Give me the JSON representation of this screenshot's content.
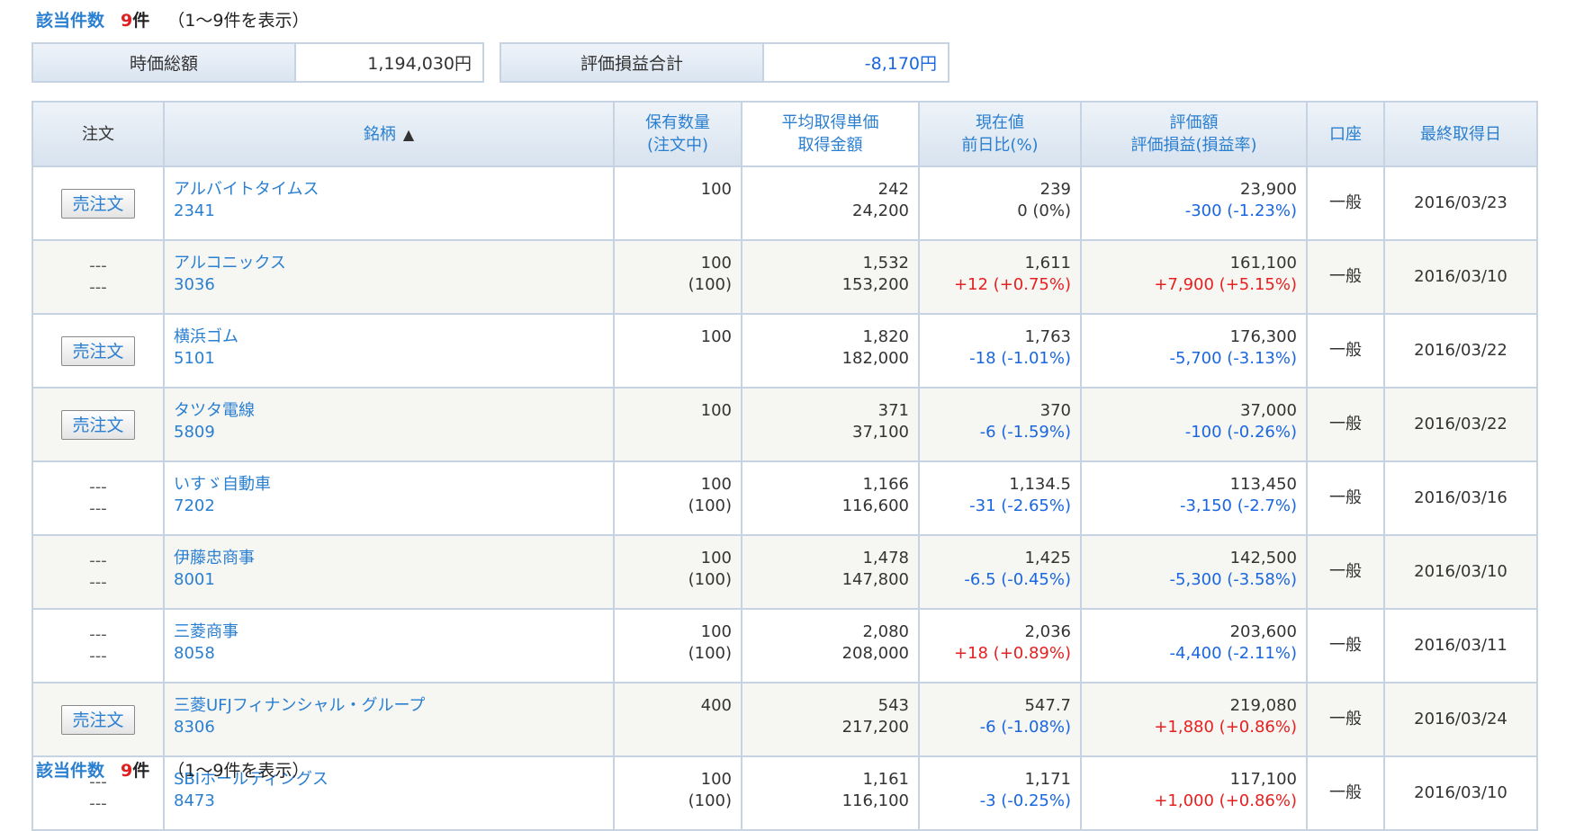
{
  "header_count": {
    "label": "該当件数",
    "count": "9",
    "unit": "件",
    "range": "（1～9件を表示）"
  },
  "summary": {
    "market_value_label": "時価総額",
    "market_value": "1,194,030円",
    "pl_total_label": "評価損益合計",
    "pl_total": "-8,170円"
  },
  "columns": {
    "order": "注文",
    "name": "銘柄",
    "sort_icon": "▲",
    "qty_1": "保有数量",
    "qty_2": "(注文中)",
    "avg_1": "平均取得単価",
    "avg_2": "取得金額",
    "price_1": "現在値",
    "price_2": "前日比(%)",
    "val_1": "評価額",
    "val_2": "評価損益(損益率)",
    "account": "口座",
    "last_date": "最終取得日"
  },
  "colors": {
    "positive": "#e62020",
    "negative": "#1a66e0",
    "link": "#2a7fd0"
  },
  "rows": [
    {
      "order_type": "button",
      "order": "売注文",
      "name": "アルバイトタイムス",
      "code": "2341",
      "qty": "100",
      "qty_pending": "",
      "avg_price": "242",
      "acq_amount": "24,200",
      "price": "239",
      "change": "0 (0%)",
      "change_sign": "zero",
      "valuation": "23,900",
      "pl": "-300 (-1.23%)",
      "pl_sign": "neg",
      "account": "一般",
      "date": "2016/03/23"
    },
    {
      "order_type": "dash",
      "order_1": "---",
      "order_2": "---",
      "name": "アルコニックス",
      "code": "3036",
      "qty": "100",
      "qty_pending": "(100)",
      "avg_price": "1,532",
      "acq_amount": "153,200",
      "price": "1,611",
      "change": "+12 (+0.75%)",
      "change_sign": "pos",
      "valuation": "161,100",
      "pl": "+7,900 (+5.15%)",
      "pl_sign": "pos",
      "account": "一般",
      "date": "2016/03/10"
    },
    {
      "order_type": "button",
      "order": "売注文",
      "name": "横浜ゴム",
      "code": "5101",
      "qty": "100",
      "qty_pending": "",
      "avg_price": "1,820",
      "acq_amount": "182,000",
      "price": "1,763",
      "change": "-18 (-1.01%)",
      "change_sign": "neg",
      "valuation": "176,300",
      "pl": "-5,700 (-3.13%)",
      "pl_sign": "neg",
      "account": "一般",
      "date": "2016/03/22"
    },
    {
      "order_type": "button",
      "order": "売注文",
      "name": "タツタ電線",
      "code": "5809",
      "qty": "100",
      "qty_pending": "",
      "avg_price": "371",
      "acq_amount": "37,100",
      "price": "370",
      "change": "-6 (-1.59%)",
      "change_sign": "neg",
      "valuation": "37,000",
      "pl": "-100 (-0.26%)",
      "pl_sign": "neg",
      "account": "一般",
      "date": "2016/03/22"
    },
    {
      "order_type": "dash",
      "order_1": "---",
      "order_2": "---",
      "name": "いすゞ自動車",
      "code": "7202",
      "qty": "100",
      "qty_pending": "(100)",
      "avg_price": "1,166",
      "acq_amount": "116,600",
      "price": "1,134.5",
      "change": "-31 (-2.65%)",
      "change_sign": "neg",
      "valuation": "113,450",
      "pl": "-3,150 (-2.7%)",
      "pl_sign": "neg",
      "account": "一般",
      "date": "2016/03/16"
    },
    {
      "order_type": "dash",
      "order_1": "---",
      "order_2": "---",
      "name": "伊藤忠商事",
      "code": "8001",
      "qty": "100",
      "qty_pending": "(100)",
      "avg_price": "1,478",
      "acq_amount": "147,800",
      "price": "1,425",
      "change": "-6.5 (-0.45%)",
      "change_sign": "neg",
      "valuation": "142,500",
      "pl": "-5,300 (-3.58%)",
      "pl_sign": "neg",
      "account": "一般",
      "date": "2016/03/10"
    },
    {
      "order_type": "dash",
      "order_1": "---",
      "order_2": "---",
      "name": "三菱商事",
      "code": "8058",
      "qty": "100",
      "qty_pending": "(100)",
      "avg_price": "2,080",
      "acq_amount": "208,000",
      "price": "2,036",
      "change": "+18 (+0.89%)",
      "change_sign": "pos",
      "valuation": "203,600",
      "pl": "-4,400 (-2.11%)",
      "pl_sign": "neg",
      "account": "一般",
      "date": "2016/03/11"
    },
    {
      "order_type": "button",
      "order": "売注文",
      "name": "三菱UFJフィナンシャル・グループ",
      "code": "8306",
      "qty": "400",
      "qty_pending": "",
      "avg_price": "543",
      "acq_amount": "217,200",
      "price": "547.7",
      "change": "-6 (-1.08%)",
      "change_sign": "neg",
      "valuation": "219,080",
      "pl": "+1,880 (+0.86%)",
      "pl_sign": "pos",
      "account": "一般",
      "date": "2016/03/24"
    },
    {
      "order_type": "dash",
      "order_1": "---",
      "order_2": "---",
      "name": "SBIホールディングス",
      "code": "8473",
      "qty": "100",
      "qty_pending": "(100)",
      "avg_price": "1,161",
      "acq_amount": "116,100",
      "price": "1,171",
      "change": "-3 (-0.25%)",
      "change_sign": "neg",
      "valuation": "117,100",
      "pl": "+1,000 (+0.86%)",
      "pl_sign": "pos",
      "account": "一般",
      "date": "2016/03/10"
    }
  ]
}
